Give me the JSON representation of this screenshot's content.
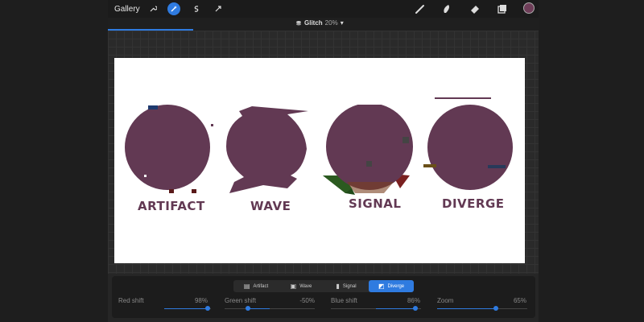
{
  "toolbar": {
    "gallery_label": "Gallery",
    "icons": [
      "wrench-icon",
      "magic-wand-icon",
      "selection-icon",
      "transform-icon",
      "brush-icon",
      "smudge-icon",
      "eraser-icon",
      "layers-icon"
    ],
    "current_color": "#6e3d58"
  },
  "document": {
    "title": "Glitch",
    "zoom": "20%"
  },
  "canvas": {
    "labels": [
      "ARTIFACT",
      "WAVE",
      "SIGNAL",
      "DIVERGE"
    ],
    "shape_color": "#623953"
  },
  "glitch_panel": {
    "tabs": [
      {
        "label": "Artifact",
        "icon": "artifact-icon",
        "active": false
      },
      {
        "label": "Wave",
        "icon": "wave-icon",
        "active": false
      },
      {
        "label": "Signal",
        "icon": "signal-icon",
        "active": false
      },
      {
        "label": "Diverge",
        "icon": "diverge-icon",
        "active": true
      }
    ],
    "sliders": [
      {
        "label": "Red shift",
        "value": "98%"
      },
      {
        "label": "Green shift",
        "value": "-50%"
      },
      {
        "label": "Blue shift",
        "value": "86%"
      },
      {
        "label": "Zoom",
        "value": "65%"
      }
    ]
  }
}
